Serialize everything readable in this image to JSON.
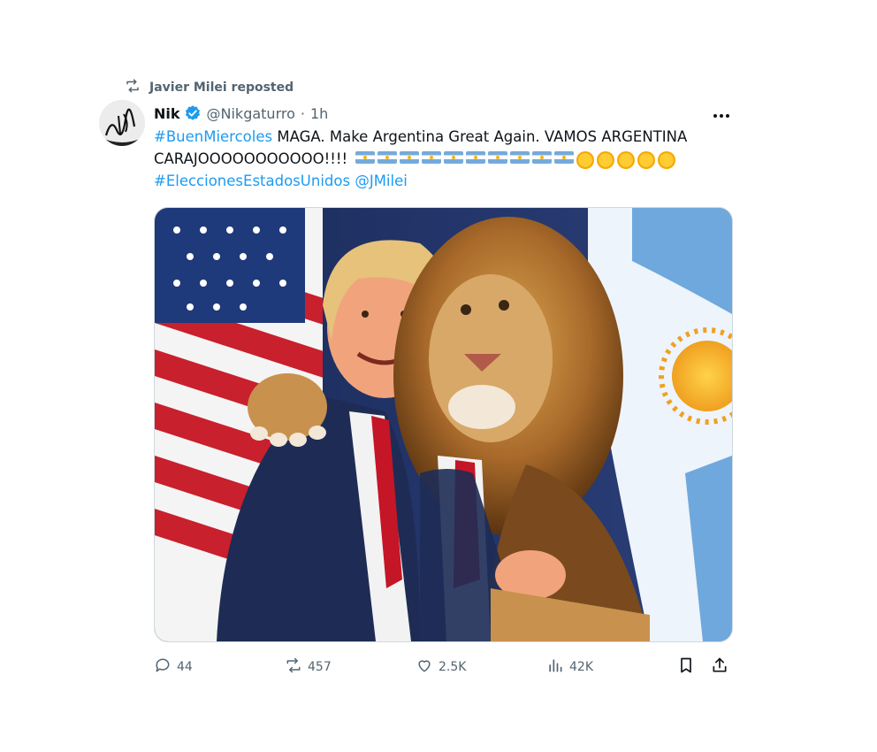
{
  "repost": {
    "text": "Javier Milei reposted"
  },
  "author": {
    "name": "Nik",
    "handle": "@Nikgaturro",
    "separator": "·",
    "time": "1h",
    "avatar_text": "Nik"
  },
  "tweet": {
    "hashtag1": "#BuenMiercoles",
    "text1": " MAGA. Make Argentina Great Again. VAMOS ARGENTINA CARAJOOOOOOOOOOO!!!! ",
    "hashtag2": "#EleccionesEstadosUnidos",
    "mention": "@JMilei",
    "emoji_flags": 10,
    "emoji_suns": 5
  },
  "media": {
    "description_icon": "image-icon"
  },
  "actions": {
    "replies": "44",
    "reposts": "457",
    "likes": "2.5K",
    "views": "42K"
  },
  "colors": {
    "accent": "#1d9bf0",
    "muted": "#536471",
    "text": "#0f1419"
  }
}
